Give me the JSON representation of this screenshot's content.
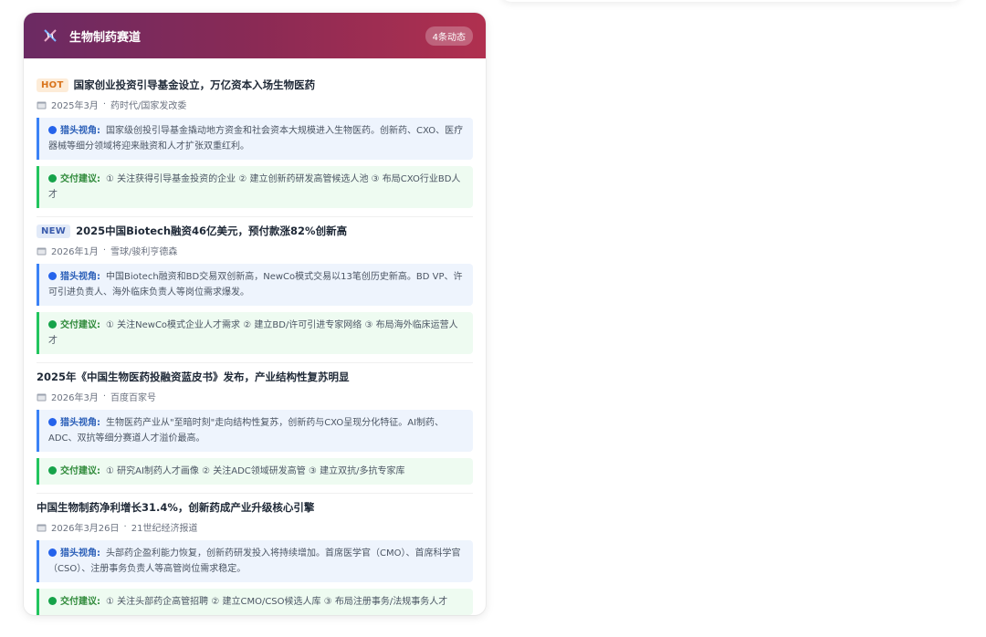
{
  "section": {
    "title": "生物制药赛道",
    "count": "4条动态",
    "accent_start": "#6b2a63",
    "accent_end": "#b0304f",
    "icon": "dna-icon"
  },
  "labels": {
    "insight": "猎头视角:",
    "advice": "交付建议:"
  },
  "items": [
    {
      "tag": "HOT",
      "title": "国家创业投资引导基金设立，万亿资本入场生物医药",
      "date": "2025年3月",
      "source": "药时代/国家发改委",
      "insight": "国家级创投引导基金撬动地方资金和社会资本大规模进入生物医药。创新药、CXO、医疗器械等细分领域将迎来融资和人才扩张双重红利。",
      "advice": "① 关注获得引导基金投资的企业 ② 建立创新药研发高管候选人池 ③ 布局CXO行业BD人才"
    },
    {
      "tag": "NEW",
      "title": "2025中国Biotech融资46亿美元，预付款涨82%创新高",
      "date": "2026年1月",
      "source": "雪球/骏利亨德森",
      "insight": "中国Biotech融资和BD交易双创新高，NewCo模式交易以13笔创历史新高。BD VP、许可引进负责人、海外临床负责人等岗位需求爆发。",
      "advice": "① 关注NewCo模式企业人才需求 ② 建立BD/许可引进专家网络 ③ 布局海外临床运营人才"
    },
    {
      "tag": "",
      "title": "2025年《中国生物医药投融资蓝皮书》发布，产业结构性复苏明显",
      "date": "2026年3月",
      "source": "百度百家号",
      "insight": "生物医药产业从\"至暗时刻\"走向结构性复苏，创新药与CXO呈现分化特征。AI制药、ADC、双抗等细分赛道人才溢价最高。",
      "advice": "① 研究AI制药人才画像 ② 关注ADC领域研发高管 ③ 建立双抗/多抗专家库"
    },
    {
      "tag": "",
      "title": "中国生物制药净利增长31.4%，创新药成产业升级核心引擎",
      "date": "2026年3月26日",
      "source": "21世纪经济报道",
      "insight": "头部药企盈利能力恢复，创新药研发投入将持续增加。首席医学官（CMO）、首席科学官（CSO）、注册事务负责人等高管岗位需求稳定。",
      "advice": "① 关注头部药企高管招聘 ② 建立CMO/CSO候选人库 ③ 布局注册事务/法规事务人才"
    }
  ]
}
